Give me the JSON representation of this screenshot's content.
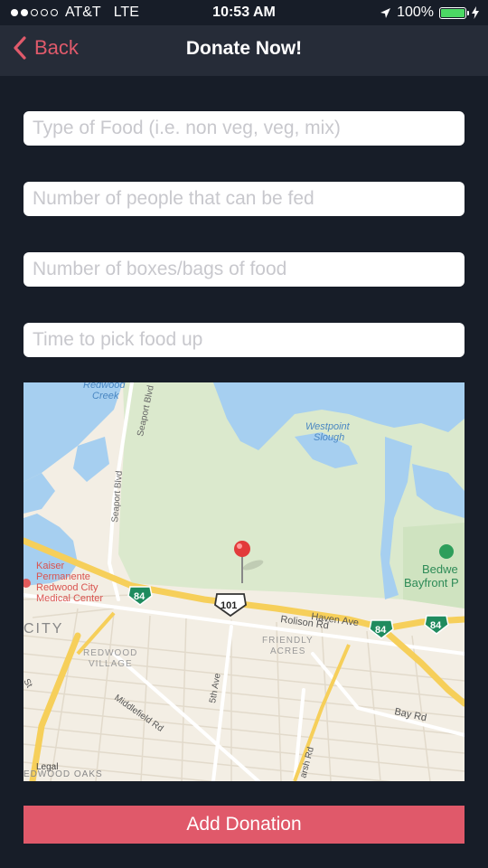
{
  "status": {
    "carrier": "AT&T",
    "network": "LTE",
    "time": "10:53 AM",
    "battery": "100%",
    "battery_level": 1.0
  },
  "nav": {
    "back_label": "Back",
    "title": "Donate Now!"
  },
  "form": {
    "food_type_placeholder": "Type of Food (i.e. non veg, veg, mix)",
    "people_placeholder": "Number of people that can be fed",
    "boxes_placeholder": "Number of boxes/bags of food",
    "pickup_time_placeholder": "Time to pick food up"
  },
  "map": {
    "labels": {
      "redwood_creek": [
        "Redwood",
        "Creek"
      ],
      "seaport_blvd": "Seaport Blvd",
      "westpoint_slough": [
        "Westpoint",
        "Slough"
      ],
      "kaiser": [
        "Kaiser",
        "Permanente",
        "Redwood City",
        "Medical Center"
      ],
      "bedwell": [
        "Bedwe",
        "Bayfront P"
      ],
      "city": "CITY",
      "hwy_84": "84",
      "hwy_101": "101",
      "haven_ave": "Haven Ave",
      "rolison_rd": "Rolison Rd",
      "friendly_acres": [
        "FRIENDLY",
        "ACRES"
      ],
      "redwood_village": [
        "REDWOOD",
        "VILLAGE"
      ],
      "fifth_ave": "5th Ave",
      "middlefield_rd": "Middlefield Rd",
      "bay_rd": "Bay Rd",
      "marsh_rd": "arsh Rd",
      "st": "St",
      "legal": "Legal",
      "redwood_oaks": "EDWOOD OAKS"
    }
  },
  "actions": {
    "add_donation_label": "Add Donation"
  }
}
